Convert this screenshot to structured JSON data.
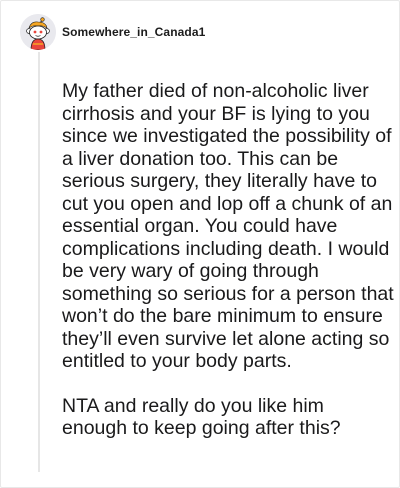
{
  "comment": {
    "author": "Somewhere_in_Canada1",
    "avatar_icon": "snoo-avatar-icon",
    "paragraphs": [
      "My father died of non-alcoholic liver cirrhosis and your BF is lying to you since we investigated the possibility of a liver donation too. This can be serious surgery, they literally have to cut you open and lop off a chunk of an essential organ. You could have complications including death. I would be very wary of going through something so serious for a person that won’t do the bare minimum to ensure they’ll even survive let alone acting so entitled to your body parts.",
      "NTA and really do you like him enough to keep going after this?"
    ]
  }
}
